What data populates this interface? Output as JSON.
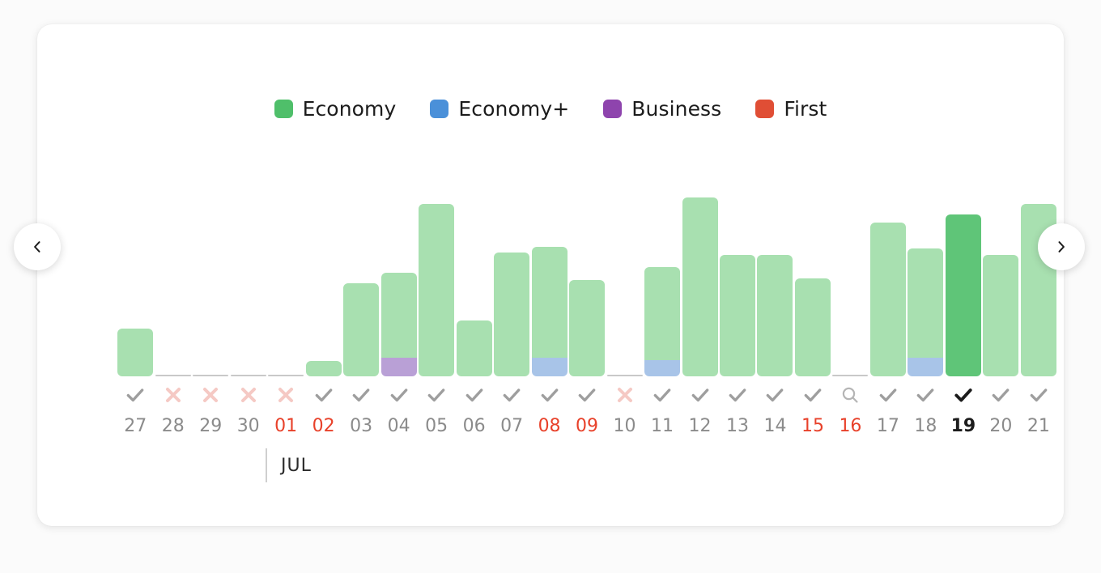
{
  "colors": {
    "background": "#fbfbfb",
    "card": "#ffffff",
    "economy": "#4fbf6a",
    "economy_plus": "#4a90d9",
    "business": "#8e44ad",
    "first": "#e04e35",
    "bar_economy": "#a8e0b0",
    "bar_economy_plus": "#a8c4e8",
    "bar_business": "#b9a0d6",
    "bar_first": "#e9a79b",
    "bar_selected": "#5fc578",
    "empty_line": "#c9c9c9",
    "check": "#9e9e9e",
    "check_selected": "#1c1c1c",
    "cross": "#f5c9c4",
    "search": "#b5b5b5",
    "date": "#8b8b8b",
    "date_weekend": "#e8412a",
    "date_selected": "#1c1c1c"
  },
  "legend": {
    "items": [
      {
        "label": "Economy",
        "color": "#4fbf6a",
        "icon": "square-swatch-icon"
      },
      {
        "label": "Economy+",
        "color": "#4a90d9",
        "icon": "square-swatch-icon"
      },
      {
        "label": "Business",
        "color": "#8e44ad",
        "icon": "square-swatch-icon"
      },
      {
        "label": "First",
        "color": "#e04e35",
        "icon": "square-swatch-icon"
      }
    ]
  },
  "month_marker": {
    "label": "JUL",
    "after_day": "02"
  },
  "nav": {
    "prev": {
      "icon": "chevron-left-icon",
      "label": "Previous dates"
    },
    "next": {
      "icon": "chevron-right-icon",
      "label": "Next dates"
    }
  },
  "chart_data": {
    "type": "bar",
    "stacked": true,
    "title": "",
    "xlabel": "",
    "ylabel": "",
    "grid": false,
    "legend_position": "top",
    "categories": [
      "27",
      "28",
      "29",
      "30",
      "01",
      "02",
      "03",
      "04",
      "05",
      "06",
      "07",
      "08",
      "09",
      "10",
      "11",
      "12",
      "13",
      "14",
      "15",
      "16",
      "17",
      "18",
      "19",
      "20",
      "21"
    ],
    "series": [
      {
        "name": "Economy",
        "color": "#a8e0b0",
        "values": [
          47,
          0,
          0,
          0,
          0,
          15,
          92,
          84,
          170,
          55,
          122,
          110,
          95,
          0,
          92,
          177,
          120,
          120,
          97,
          0,
          152,
          108,
          160,
          120,
          170
        ]
      },
      {
        "name": "Economy+",
        "color": "#a8c4e8",
        "values": [
          0,
          0,
          0,
          0,
          0,
          0,
          0,
          0,
          0,
          0,
          0,
          18,
          0,
          0,
          16,
          0,
          0,
          0,
          0,
          0,
          0,
          18,
          0,
          0,
          0
        ]
      },
      {
        "name": "Business",
        "color": "#b9a0d6",
        "values": [
          0,
          0,
          0,
          0,
          0,
          0,
          0,
          18,
          0,
          0,
          0,
          0,
          0,
          0,
          0,
          0,
          0,
          0,
          0,
          0,
          0,
          0,
          0,
          0,
          0
        ]
      },
      {
        "name": "First",
        "color": "#e9a79b",
        "values": [
          0,
          0,
          0,
          0,
          0,
          0,
          0,
          0,
          0,
          0,
          0,
          0,
          0,
          0,
          0,
          0,
          0,
          0,
          0,
          0,
          0,
          0,
          0,
          0,
          0
        ]
      }
    ],
    "ylim": [
      0,
      200
    ]
  },
  "days": [
    {
      "date": "27",
      "weekend": false,
      "selected": false,
      "status": "check",
      "empty": false,
      "segments": [
        {
          "series": "Economy",
          "color": "#a8e0b0",
          "value": 47
        }
      ]
    },
    {
      "date": "28",
      "weekend": false,
      "selected": false,
      "status": "cross",
      "empty": true,
      "segments": []
    },
    {
      "date": "29",
      "weekend": false,
      "selected": false,
      "status": "cross",
      "empty": true,
      "segments": []
    },
    {
      "date": "30",
      "weekend": false,
      "selected": false,
      "status": "cross",
      "empty": true,
      "segments": []
    },
    {
      "date": "01",
      "weekend": true,
      "selected": false,
      "status": "cross",
      "empty": true,
      "segments": []
    },
    {
      "date": "02",
      "weekend": true,
      "selected": false,
      "status": "check",
      "empty": false,
      "segments": [
        {
          "series": "Economy",
          "color": "#a8e0b0",
          "value": 15
        }
      ]
    },
    {
      "date": "03",
      "weekend": false,
      "selected": false,
      "status": "check",
      "empty": false,
      "segments": [
        {
          "series": "Economy",
          "color": "#a8e0b0",
          "value": 92
        }
      ]
    },
    {
      "date": "04",
      "weekend": false,
      "selected": false,
      "status": "check",
      "empty": false,
      "segments": [
        {
          "series": "Economy",
          "color": "#a8e0b0",
          "value": 84
        },
        {
          "series": "Business",
          "color": "#b9a0d6",
          "value": 18
        }
      ]
    },
    {
      "date": "05",
      "weekend": false,
      "selected": false,
      "status": "check",
      "empty": false,
      "segments": [
        {
          "series": "Economy",
          "color": "#a8e0b0",
          "value": 170
        }
      ]
    },
    {
      "date": "06",
      "weekend": false,
      "selected": false,
      "status": "check",
      "empty": false,
      "segments": [
        {
          "series": "Economy",
          "color": "#a8e0b0",
          "value": 55
        }
      ]
    },
    {
      "date": "07",
      "weekend": false,
      "selected": false,
      "status": "check",
      "empty": false,
      "segments": [
        {
          "series": "Economy",
          "color": "#a8e0b0",
          "value": 122
        }
      ]
    },
    {
      "date": "08",
      "weekend": true,
      "selected": false,
      "status": "check",
      "empty": false,
      "segments": [
        {
          "series": "Economy",
          "color": "#a8e0b0",
          "value": 110
        },
        {
          "series": "Economy+",
          "color": "#a8c4e8",
          "value": 18
        }
      ]
    },
    {
      "date": "09",
      "weekend": true,
      "selected": false,
      "status": "check",
      "empty": false,
      "segments": [
        {
          "series": "Economy",
          "color": "#a8e0b0",
          "value": 95
        }
      ]
    },
    {
      "date": "10",
      "weekend": false,
      "selected": false,
      "status": "cross",
      "empty": true,
      "segments": []
    },
    {
      "date": "11",
      "weekend": false,
      "selected": false,
      "status": "check",
      "empty": false,
      "segments": [
        {
          "series": "Economy",
          "color": "#a8e0b0",
          "value": 92
        },
        {
          "series": "Economy+",
          "color": "#a8c4e8",
          "value": 16
        }
      ]
    },
    {
      "date": "12",
      "weekend": false,
      "selected": false,
      "status": "check",
      "empty": false,
      "segments": [
        {
          "series": "Economy",
          "color": "#a8e0b0",
          "value": 177
        }
      ]
    },
    {
      "date": "13",
      "weekend": false,
      "selected": false,
      "status": "check",
      "empty": false,
      "segments": [
        {
          "series": "Economy",
          "color": "#a8e0b0",
          "value": 120
        }
      ]
    },
    {
      "date": "14",
      "weekend": false,
      "selected": false,
      "status": "check",
      "empty": false,
      "segments": [
        {
          "series": "Economy",
          "color": "#a8e0b0",
          "value": 120
        }
      ]
    },
    {
      "date": "15",
      "weekend": true,
      "selected": false,
      "status": "check",
      "empty": false,
      "segments": [
        {
          "series": "Economy",
          "color": "#a8e0b0",
          "value": 97
        }
      ]
    },
    {
      "date": "16",
      "weekend": true,
      "selected": false,
      "status": "search",
      "empty": true,
      "segments": []
    },
    {
      "date": "17",
      "weekend": false,
      "selected": false,
      "status": "check",
      "empty": false,
      "segments": [
        {
          "series": "Economy",
          "color": "#a8e0b0",
          "value": 152
        }
      ]
    },
    {
      "date": "18",
      "weekend": false,
      "selected": false,
      "status": "check",
      "empty": false,
      "segments": [
        {
          "series": "Economy",
          "color": "#a8e0b0",
          "value": 108
        },
        {
          "series": "Economy+",
          "color": "#a8c4e8",
          "value": 18
        }
      ]
    },
    {
      "date": "19",
      "weekend": false,
      "selected": true,
      "status": "check",
      "empty": false,
      "segments": [
        {
          "series": "Economy",
          "color": "#5fc578",
          "value": 160
        }
      ]
    },
    {
      "date": "20",
      "weekend": false,
      "selected": false,
      "status": "check",
      "empty": false,
      "segments": [
        {
          "series": "Economy",
          "color": "#a8e0b0",
          "value": 120
        }
      ]
    },
    {
      "date": "21",
      "weekend": false,
      "selected": false,
      "status": "check",
      "empty": false,
      "segments": [
        {
          "series": "Economy",
          "color": "#a8e0b0",
          "value": 170
        }
      ]
    }
  ]
}
